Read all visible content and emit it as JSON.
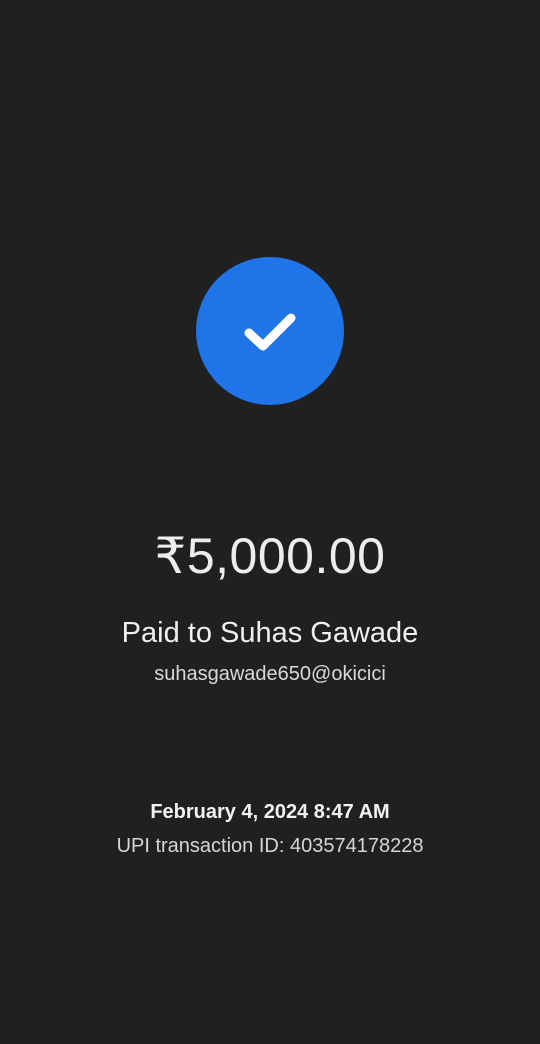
{
  "status": {
    "icon": "check-icon",
    "accent_color": "#1f74e8"
  },
  "payment": {
    "amount": "₹5,000.00",
    "paid_to": "Paid to Suhas Gawade",
    "payee_upi_id": "suhasgawade650@okicici"
  },
  "transaction": {
    "datetime": "February 4, 2024 8:47 AM",
    "upi_transaction_id": "UPI transaction ID: 403574178228"
  }
}
